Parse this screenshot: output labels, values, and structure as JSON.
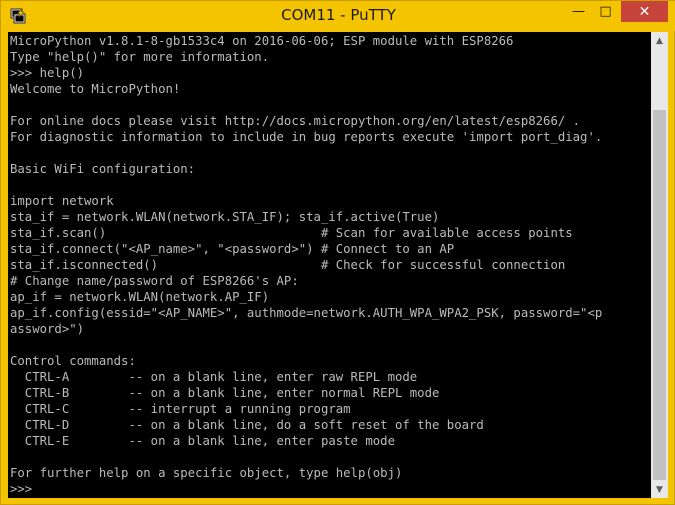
{
  "window": {
    "title": "COM11 - PuTTY",
    "min_glyph": "—",
    "max_glyph": "□",
    "close_glyph": "✕",
    "app_icon": "putty-terminal-icon"
  },
  "terminal": {
    "lines": [
      "MicroPython v1.8.1-8-gb1533c4 on 2016-06-06; ESP module with ESP8266",
      "Type \"help()\" for more information.",
      ">>> help()",
      "Welcome to MicroPython!",
      "",
      "For online docs please visit http://docs.micropython.org/en/latest/esp8266/ .",
      "For diagnostic information to include in bug reports execute 'import port_diag'.",
      "",
      "Basic WiFi configuration:",
      "",
      "import network",
      "sta_if = network.WLAN(network.STA_IF); sta_if.active(True)",
      "sta_if.scan()                             # Scan for available access points",
      "sta_if.connect(\"<AP_name>\", \"<password>\") # Connect to an AP",
      "sta_if.isconnected()                      # Check for successful connection",
      "# Change name/password of ESP8266's AP:",
      "ap_if = network.WLAN(network.AP_IF)",
      "ap_if.config(essid=\"<AP_NAME>\", authmode=network.AUTH_WPA_WPA2_PSK, password=\"<p",
      "assword>\")",
      "",
      "Control commands:",
      "  CTRL-A        -- on a blank line, enter raw REPL mode",
      "  CTRL-B        -- on a blank line, enter normal REPL mode",
      "  CTRL-C        -- interrupt a running program",
      "  CTRL-D        -- on a blank line, do a soft reset of the board",
      "  CTRL-E        -- on a blank line, enter paste mode",
      "",
      "For further help on a specific object, type help(obj)",
      ">>>"
    ]
  },
  "scrollbar": {
    "up_glyph": "▲",
    "down_glyph": "▼",
    "position_fraction": 0.16
  },
  "colors": {
    "titlebar": "#f5c400",
    "terminal_bg": "#000000",
    "terminal_fg": "#bbbbbb",
    "close_button": "#c7443a"
  }
}
